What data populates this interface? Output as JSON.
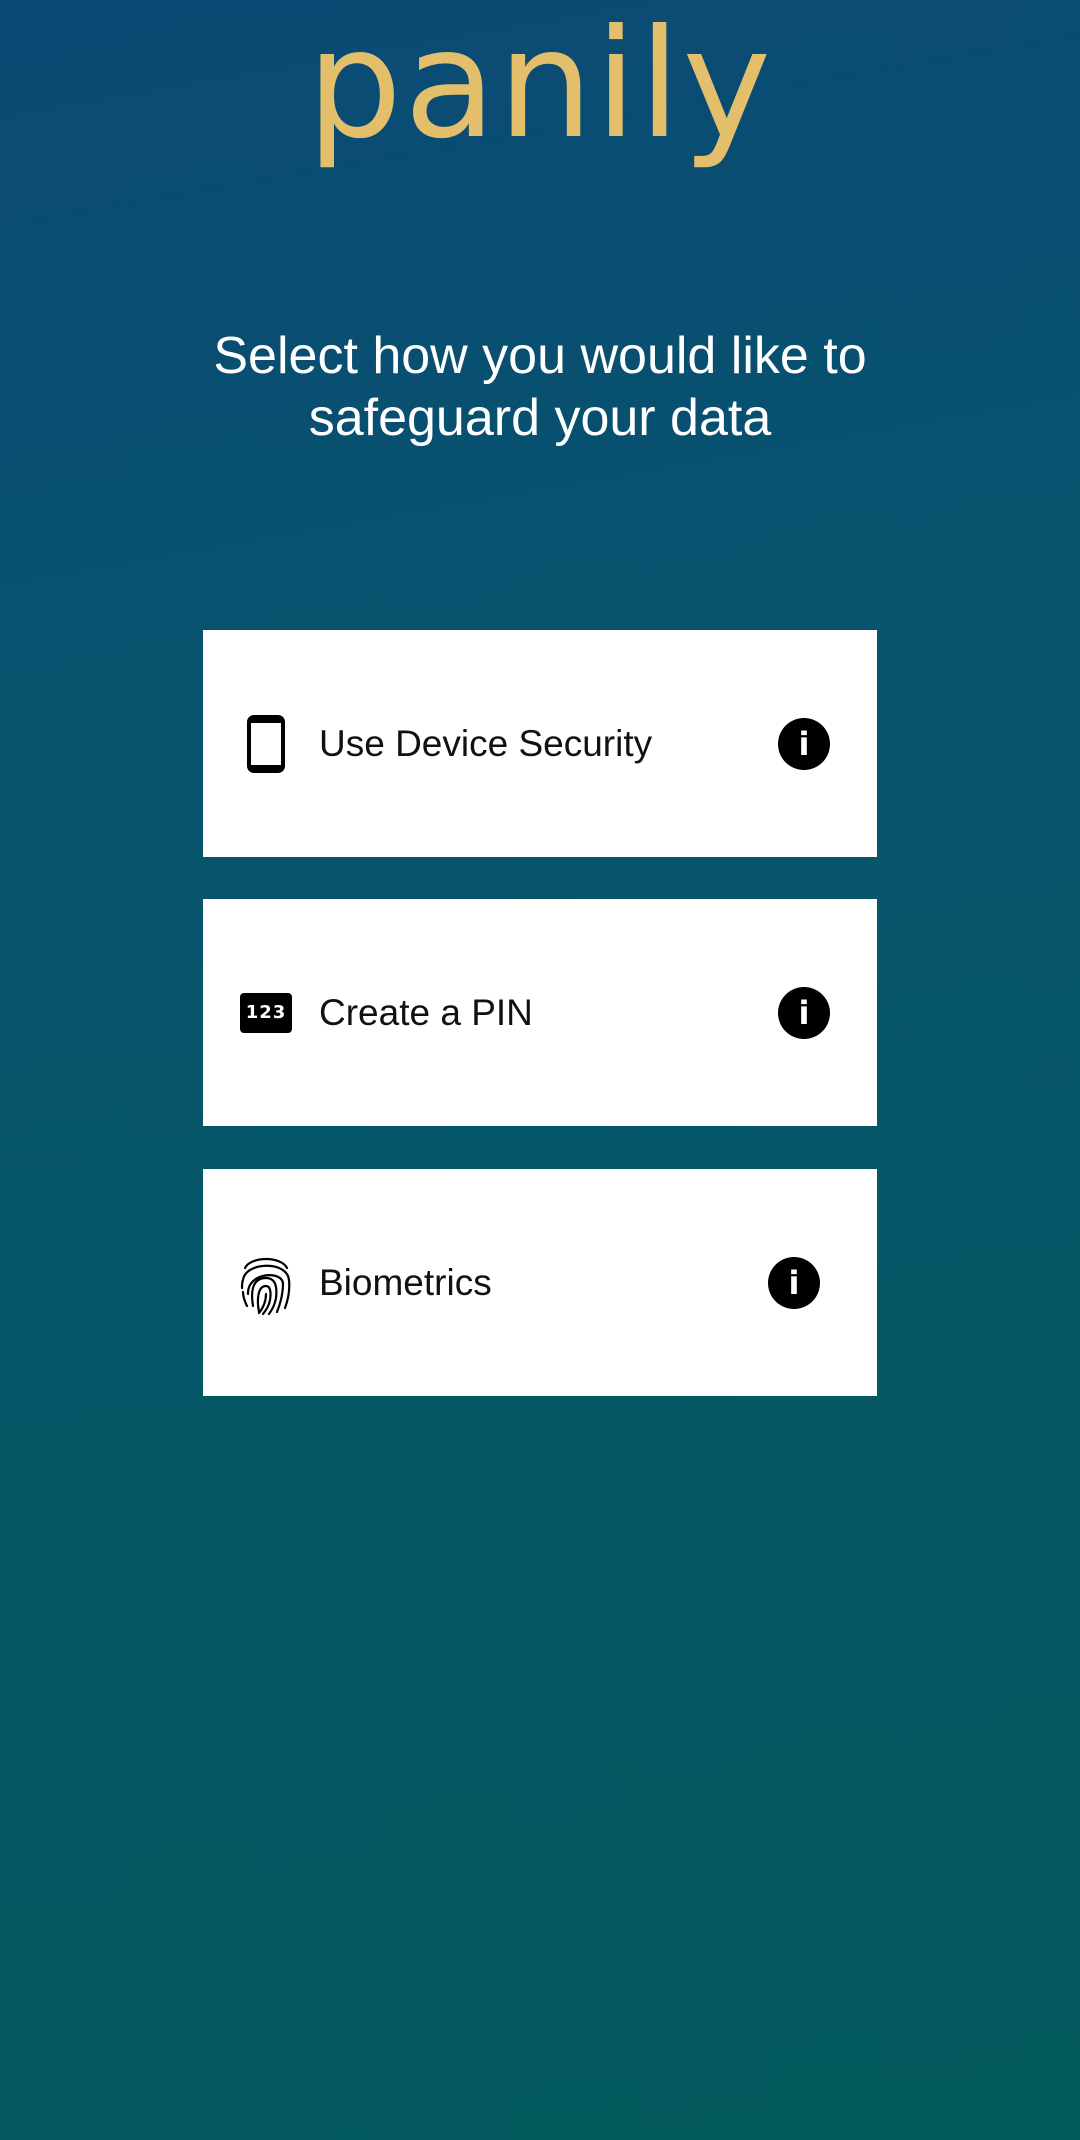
{
  "app": {
    "logo_text": "panily",
    "logo_color": "#e3bf6b"
  },
  "header": {
    "subtitle": "Select how you would like to safeguard your data"
  },
  "options": [
    {
      "label": "Use Device Security",
      "icon": "phone-icon",
      "info_icon": "info-icon"
    },
    {
      "label": "Create a PIN",
      "icon": "pin-123-icon",
      "pin_text": "123",
      "info_icon": "info-icon"
    },
    {
      "label": "Biometrics",
      "icon": "fingerprint-icon",
      "info_icon": "info-icon"
    }
  ],
  "colors": {
    "background_top": "#0a4a75",
    "background_bottom": "#035a5c",
    "card": "#ffffff",
    "text_light": "#ffffff"
  }
}
